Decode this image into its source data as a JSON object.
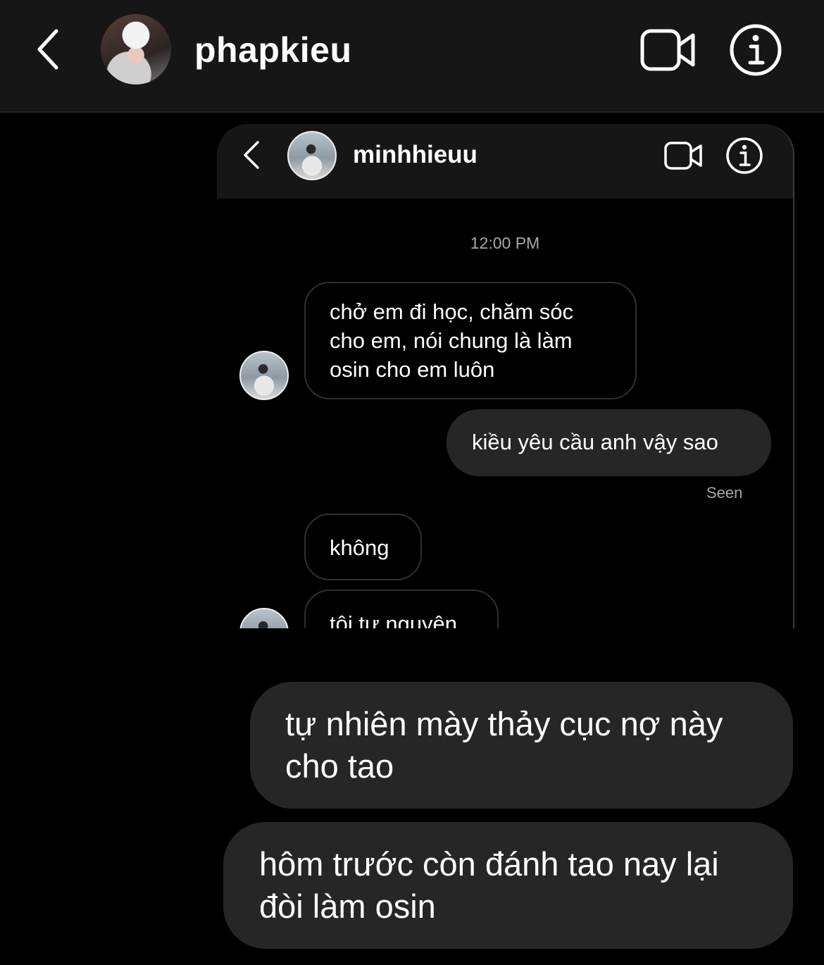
{
  "header": {
    "username": "phapkieu",
    "icons": {
      "back": "chevron-left-icon",
      "video": "video-call-icon",
      "info": "info-icon"
    }
  },
  "screenshot": {
    "username": "minhhieuu",
    "timestamp": "12:00 PM",
    "messages": [
      {
        "from": "them",
        "text": "chở em đi học, chăm sóc cho em, nói chung là làm osin cho em luôn"
      },
      {
        "from": "me",
        "text": "kiều yêu cầu anh vậy sao"
      },
      {
        "from": "them",
        "text": "không"
      },
      {
        "from": "them",
        "text": "tôi tự nguyện"
      }
    ],
    "seen_label": "Seen"
  },
  "messages": [
    {
      "from": "me",
      "text": "tự nhiên mày thảy cục nợ này cho tao"
    },
    {
      "from": "me",
      "text": "hôm trước còn đánh tao nay lại đòi làm osin"
    }
  ],
  "colors": {
    "background": "#000000",
    "header_bg": "#161616",
    "bubble_out": "#262626",
    "muted_text": "#a8a8a8"
  }
}
